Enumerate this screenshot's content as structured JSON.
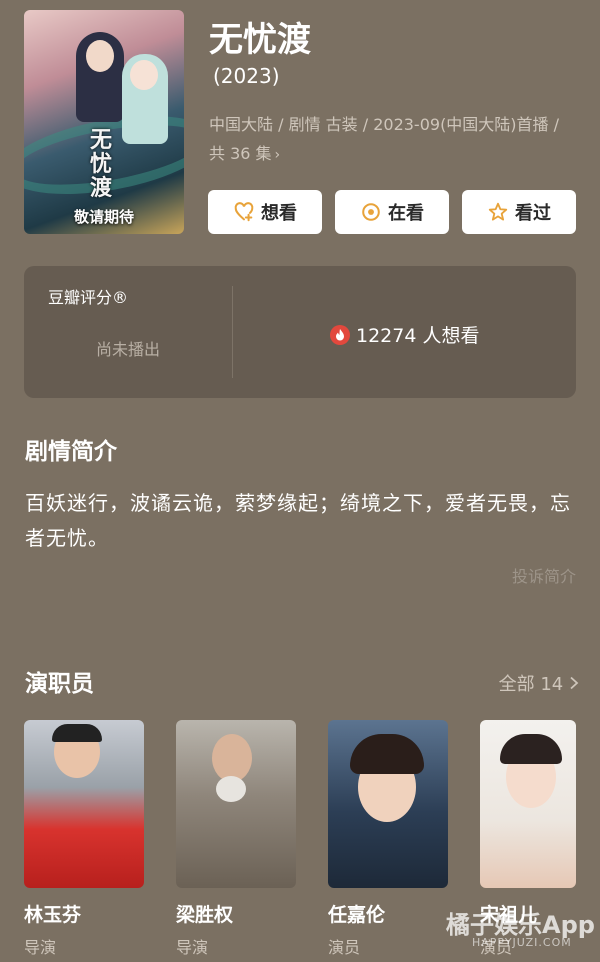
{
  "poster": {
    "calligraphy": "无忧渡",
    "tagline": "敬请期待"
  },
  "header": {
    "title": "无忧渡",
    "year": "(2023)",
    "meta": "中国大陆 / 剧情 古装 / 2023-09(中国大陆)首播 / 共 36 集",
    "meta_chevron": "›"
  },
  "actions": [
    {
      "label": "想看",
      "icon": "heart-plus-icon",
      "color": "#e8a33a"
    },
    {
      "label": "在看",
      "icon": "target-icon",
      "color": "#e8a33a"
    },
    {
      "label": "看过",
      "icon": "star-icon",
      "color": "#e8a33a"
    }
  ],
  "rating": {
    "label": "豆瓣评分®",
    "status": "尚未播出",
    "wish_count": "12274 人想看",
    "icon": "fire-icon"
  },
  "synopsis": {
    "title": "剧情简介",
    "text": "百妖迷行，波谲云诡，萦梦缘起；绮境之下，爱者无畏，忘者无忧。",
    "report": "投诉简介"
  },
  "cast": {
    "title": "演职员",
    "all_label": "全部 14",
    "members": [
      {
        "name": "林玉芬",
        "role": "导演"
      },
      {
        "name": "梁胜权",
        "role": "导演"
      },
      {
        "name": "任嘉伦",
        "role": "演员"
      },
      {
        "name": "宋祖儿",
        "role": "演员"
      }
    ]
  },
  "watermark": {
    "text": "橘子娱乐App",
    "sub": "HAPPYJUZI.COM"
  },
  "colors": {
    "background": "#7b7062",
    "card": "#665c51",
    "accent": "#e8a33a",
    "fire": "#e2483d"
  }
}
